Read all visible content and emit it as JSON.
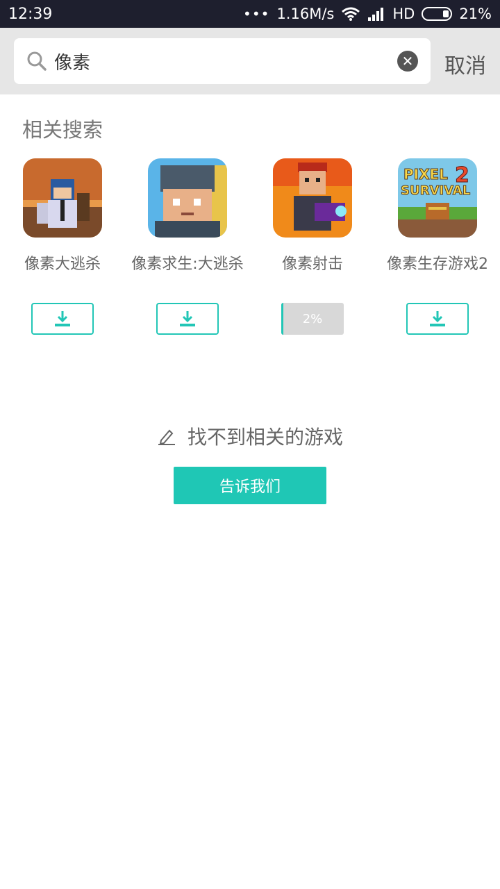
{
  "status": {
    "time": "12:39",
    "dots": "•••",
    "speed": "1.16M/s",
    "network": "HD",
    "battery": "21%"
  },
  "search": {
    "value": "像素",
    "cancel_label": "取消"
  },
  "related": {
    "title": "相关搜索",
    "apps": [
      {
        "label": "像素大逃杀",
        "action": "download"
      },
      {
        "label": "像素求生:大逃杀",
        "action": "download"
      },
      {
        "label": "像素射击",
        "action": "progress",
        "progress_text": "2%",
        "progress": 0.02
      },
      {
        "label": "像素生存游戏2",
        "action": "download"
      }
    ]
  },
  "icon4": {
    "line1": "PIXEL",
    "line2": "SURVIVAL",
    "num": "2"
  },
  "not_found": {
    "text": "找不到相关的游戏",
    "button_label": "告诉我们"
  },
  "colors": {
    "accent": "#1fc7b5",
    "status_bar": "#1e1f2e",
    "header_bg": "#e6e6e6"
  }
}
